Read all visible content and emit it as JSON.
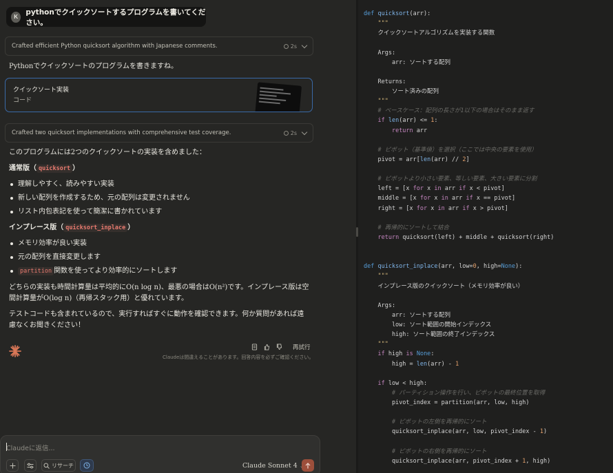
{
  "user": {
    "initial": "K",
    "message": "pythonでクイックソートするプログラムを書いてください。"
  },
  "thought1": {
    "text": "Crafted efficient Python quicksort algorithm with Japanese comments.",
    "time": "2s"
  },
  "intro": "Pythonでクイックソートのプログラムを書きますね。",
  "artifact": {
    "title": "クイックソート実装",
    "subtitle": "コード"
  },
  "thought2": {
    "text": "Crafted two quicksort implementations with comprehensive test coverage.",
    "time": "2s"
  },
  "summary": "このプログラムには2つのクイックソートの実装を含めました：",
  "section1": {
    "prefix": "通常版（",
    "code": "quicksort",
    "suffix": "）"
  },
  "section1_items": [
    "理解しやすく、読みやすい実装",
    "新しい配列を作成するため、元の配列は変更されません",
    "リスト内包表記を使って簡潔に書かれています"
  ],
  "section2": {
    "prefix": "インプレース版（",
    "code": "quicksort_inplace",
    "suffix": "）"
  },
  "section2_items": {
    "item1": "メモリ効率が良い実装",
    "item2": "元の配列を直接変更します",
    "item3_code": "partition",
    "item3_text": "関数を使ってより効率的にソートします"
  },
  "complexity_line1": "どちらの実装も時間計算量は平均的にO(n log n)、最悪の場合はO(n²)です。インプレース版は空",
  "complexity_line2": "間計算量がO(log n)（再帰スタック用）と優れています。",
  "closing_line1": "テストコードも含まれているので、実行すればすぐに動作を確認できます。何か質問があれば遠",
  "closing_line2": "慮なくお聞きください！",
  "actions": {
    "retry": "再試行",
    "disclaimer": "Claudeは間違えることがあります。回答内容を必ずご確認ください。"
  },
  "composer": {
    "placeholder": "Claudeに返信...",
    "research": "リサーチ",
    "model": "Claude Sonnet 4"
  },
  "colors": {
    "accent": "#d97757",
    "artifact_border": "#3a6aa8",
    "send": "#9c4f3b"
  },
  "code_lines": [
    "def quicksort(arr):",
    "    \"\"\"",
    "    クイックソートアルゴリズムを実装する関数",
    "",
    "    Args:",
    "        arr: ソートする配列",
    "",
    "    Returns:",
    "        ソート済みの配列",
    "    \"\"\"",
    "    # ベースケース：配列の長さが1以下の場合はそのまま返す",
    "    if len(arr) <= 1:",
    "        return arr",
    "",
    "    # ピボット（基準値）を選択（ここでは中央の要素を使用）",
    "    pivot = arr[len(arr) // 2]",
    "",
    "    # ピボットより小さい要素、等しい要素、大きい要素に分割",
    "    left = [x for x in arr if x < pivot]",
    "    middle = [x for x in arr if x == pivot]",
    "    right = [x for x in arr if x > pivot]",
    "",
    "    # 再帰的にソートして結合",
    "    return quicksort(left) + middle + quicksort(right)",
    "",
    "",
    "def quicksort_inplace(arr, low=0, high=None):",
    "    \"\"\"",
    "    インプレース版のクイックソート（メモリ効率が良い）",
    "",
    "    Args:",
    "        arr: ソートする配列",
    "        low: ソート範囲の開始インデックス",
    "        high: ソート範囲の終了インデックス",
    "    \"\"\"",
    "    if high is None:",
    "        high = len(arr) - 1",
    "",
    "    if low < high:",
    "        # パーティション操作を行い、ピボットの最終位置を取得",
    "        pivot_index = partition(arr, low, high)",
    "",
    "        # ピボットの左側を再帰的にソート",
    "        quicksort_inplace(arr, low, pivot_index - 1)",
    "",
    "        # ピボットの右側を再帰的にソート",
    "        quicksort_inplace(arr, pivot_index + 1, high)"
  ]
}
